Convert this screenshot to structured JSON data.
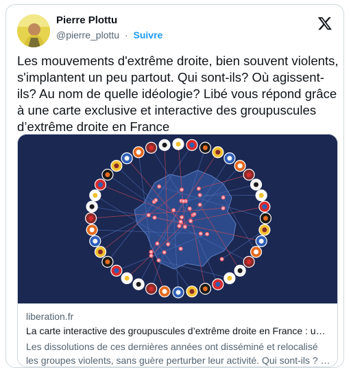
{
  "author": {
    "name": "Pierre Plottu",
    "handle": "@pierre_plottu",
    "separator": "·",
    "follow_label": "Suivre"
  },
  "tweet": {
    "text": "Les mouvements d'extrême droite, bien souvent violents, s'implantent un peu partout. Qui sont-ils? Où agissent-ils? Au nom de quelle idéologie? Libé vous répond grâce à une carte exclusive et interactive des groupuscules d’extrême droite en France"
  },
  "link_card": {
    "domain": "liberation.fr",
    "title": "La carte interactive des groupuscules d’extrême droite en France : un…",
    "description": "Les dissolutions de ces dernières années ont disséminé et relocalisé les groupes violents, sans guère perturber leur activité. Qui sont-ils ? …"
  },
  "colors": {
    "accent": "#1d9bf0",
    "map_background": "#1b2852",
    "france_fill": "#2c4a8a",
    "marker": "#e8505b"
  },
  "icons": {
    "logo": "x-logo-icon"
  }
}
